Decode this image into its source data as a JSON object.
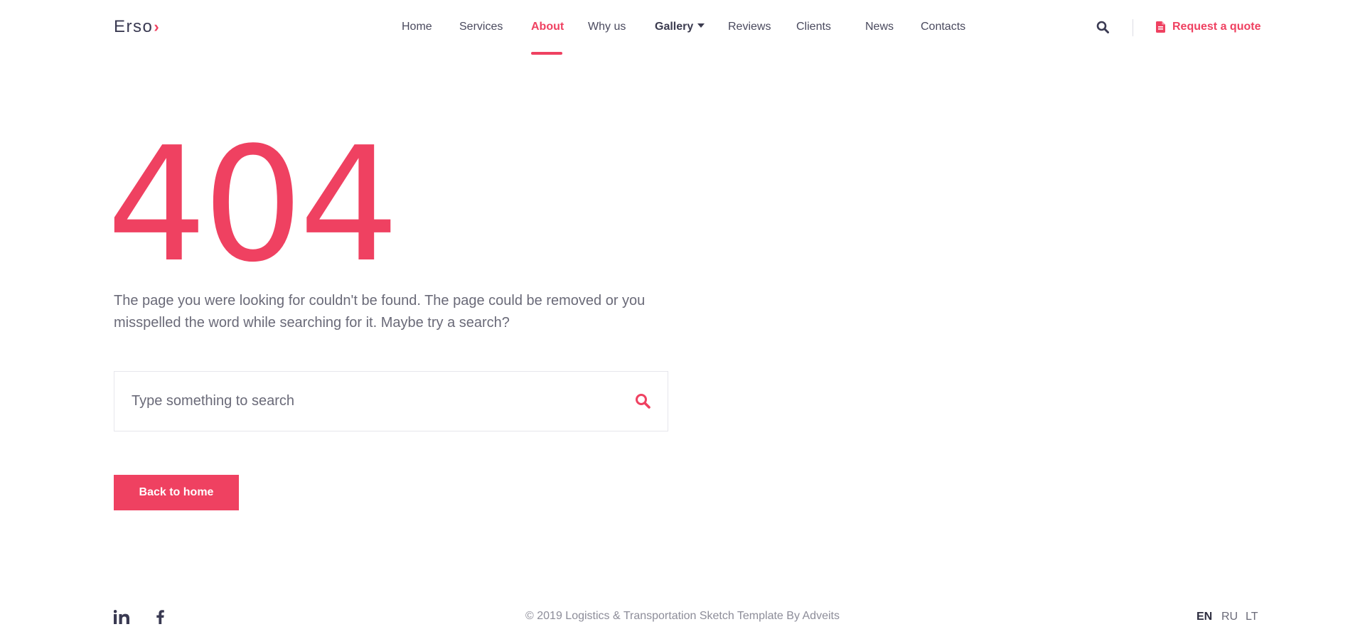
{
  "brand": {
    "logo_text": "Erso",
    "logo_mark": "›",
    "accent_color": "#ef4161"
  },
  "nav": {
    "items": [
      {
        "label": "Home"
      },
      {
        "label": "Services"
      },
      {
        "label": "About",
        "active": true
      },
      {
        "label": "Why us"
      },
      {
        "label": "Gallery",
        "has_dropdown": true
      },
      {
        "label": "Reviews"
      },
      {
        "label": "Clients"
      },
      {
        "label": "News"
      },
      {
        "label": "Contacts"
      }
    ],
    "search_icon": "search-icon",
    "quote_label": "Request a quote",
    "quote_icon": "document-icon"
  },
  "error": {
    "code": "404",
    "message": "The page you were looking for couldn't be found. The page could be removed or you misspelled the word while searching for it. Maybe try a search?"
  },
  "search": {
    "placeholder": "Type something to search",
    "value": "",
    "button_icon": "search-icon"
  },
  "home_button": {
    "label": "Back to home"
  },
  "footer": {
    "social": [
      {
        "icon": "linkedin-icon",
        "label": "in"
      },
      {
        "icon": "facebook-icon",
        "label": "f"
      }
    ],
    "copyright": "© 2019 Logistics & Transportation Sketch Template By Adveits",
    "languages": [
      {
        "label": "EN",
        "active": true
      },
      {
        "label": "RU"
      },
      {
        "label": "LT"
      }
    ]
  }
}
